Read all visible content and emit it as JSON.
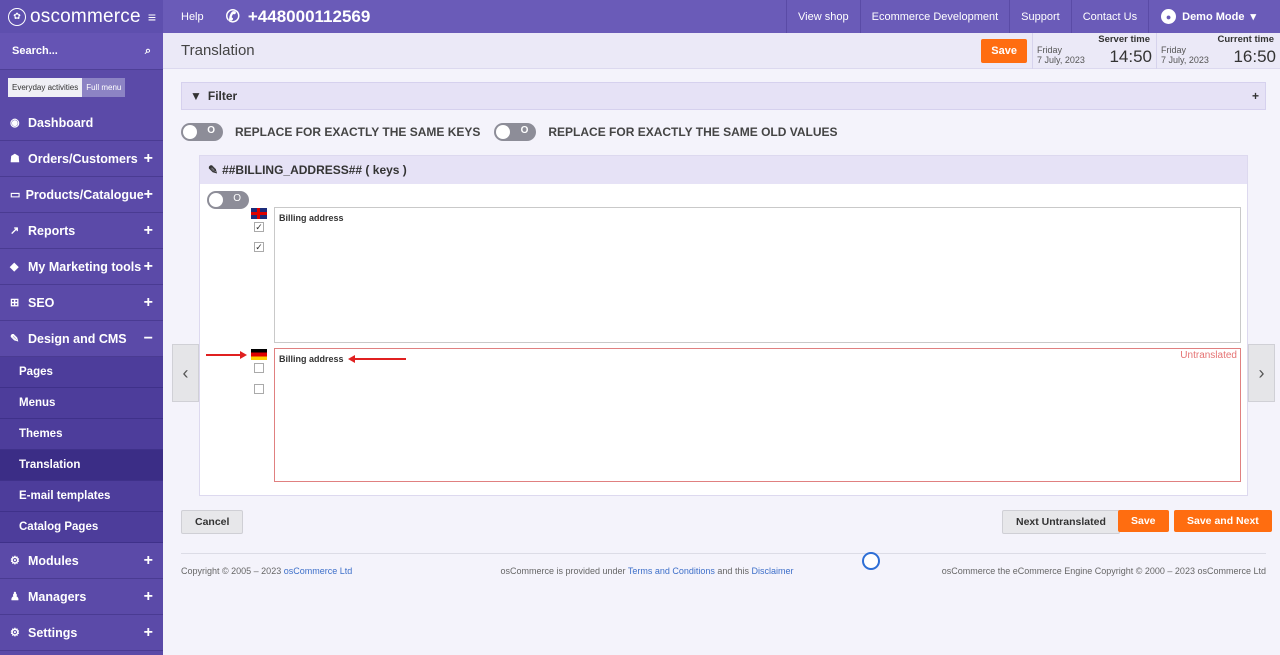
{
  "topbar": {
    "logo": "oscommerce",
    "logo_mark": "✿",
    "help": "Help",
    "phone": "+448000112569",
    "links": [
      "View shop",
      "Ecommerce Development",
      "Support",
      "Contact Us"
    ],
    "user": "Demo Mode"
  },
  "sidebar": {
    "search": "Search...",
    "mode_tabs": [
      "Everyday activities",
      "Full menu"
    ],
    "items": [
      {
        "label": "Dashboard",
        "icon": "dashboard-icon"
      },
      {
        "label": "Orders/Customers",
        "icon": "users-icon"
      },
      {
        "label": "Products/Catalogue",
        "icon": "folder-icon"
      },
      {
        "label": "Reports",
        "icon": "chart-icon"
      },
      {
        "label": "My Marketing tools",
        "icon": "tag-icon"
      },
      {
        "label": "SEO",
        "icon": "sitemap-icon"
      },
      {
        "label": "Design and CMS",
        "icon": "brush-icon"
      }
    ],
    "sub_items": [
      "Pages",
      "Menus",
      "Themes",
      "Translation",
      "E-mail templates",
      "Catalog Pages"
    ],
    "bottom_items": [
      {
        "label": "Modules",
        "icon": "modules-icon"
      },
      {
        "label": "Managers",
        "icon": "manager-icon"
      },
      {
        "label": "Settings",
        "icon": "settings-icon"
      }
    ]
  },
  "header": {
    "title": "Translation",
    "save": "Save",
    "server_time": {
      "label": "Server time",
      "day": "Friday",
      "date": "7 July, 2023",
      "time": "14:50"
    },
    "current_time": {
      "label": "Current time",
      "day": "Friday",
      "date": "7 July, 2023",
      "time": "16:50"
    }
  },
  "filter": {
    "label": "Filter",
    "plus": "+"
  },
  "toggles": {
    "state": "O",
    "same_keys": "REPLACE FOR EXACTLY THE SAME KEYS",
    "same_old_values": "REPLACE FOR EXACTLY THE SAME OLD VALUES"
  },
  "panel": {
    "title": "##BILLING_ADDRESS## ( keys )",
    "en_value": "Billing address",
    "de_value": "Billing address",
    "untranslated": "Untranslated"
  },
  "buttons": {
    "cancel": "Cancel",
    "next_untranslated": "Next Untranslated",
    "save": "Save",
    "save_next": "Save and Next"
  },
  "footer": {
    "left_prefix": "Copyright © 2005 – 2023",
    "left_link": "osCommerce Ltd",
    "mid_prefix": "osCommerce is provided under",
    "mid_link1": "Terms and Conditions",
    "mid_and": "and this",
    "mid_link2": "Disclaimer",
    "right": "osCommerce the eCommerce Engine Copyright © 2000 – 2023 osCommerce Ltd"
  },
  "colors": {
    "brand": "#6a5bb8",
    "accent": "#ff6d10",
    "untranslated": "#e57373"
  }
}
